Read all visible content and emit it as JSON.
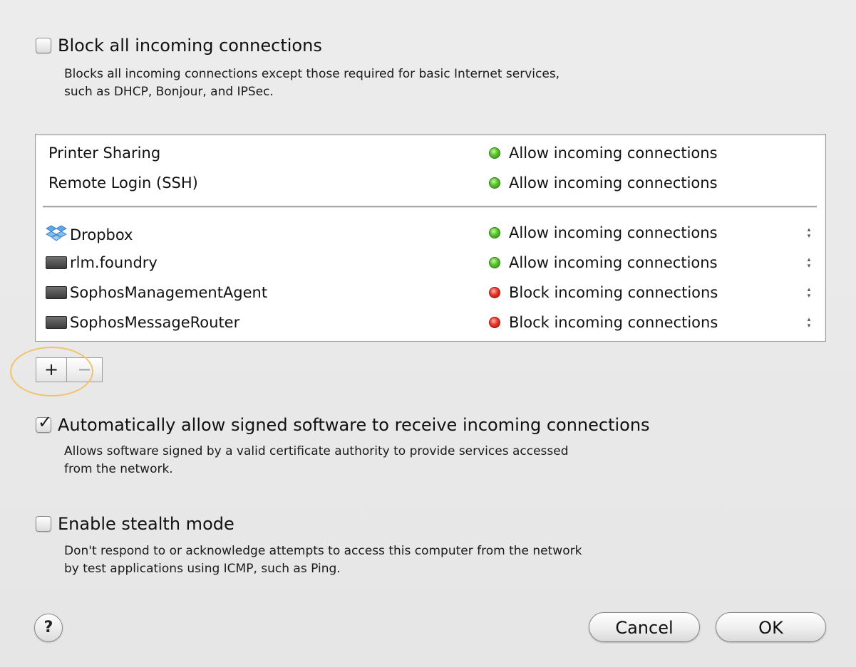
{
  "block_all": {
    "label": "Block all incoming connections",
    "checked": false,
    "description_line1": "Blocks all incoming connections except those required for basic Internet services,",
    "description_line2": "such as DHCP, Bonjour, and IPSec."
  },
  "services": [
    {
      "name": "Printer Sharing",
      "status": "Allow incoming connections",
      "status_color": "#4fbf26"
    },
    {
      "name": "Remote Login (SSH)",
      "status": "Allow incoming connections",
      "status_color": "#4fbf26"
    }
  ],
  "apps": [
    {
      "name": "Dropbox",
      "icon": "dropbox-icon",
      "status": "Allow incoming connections",
      "status_color": "#4fbf26"
    },
    {
      "name": "rlm.foundry",
      "icon": "application-icon",
      "status": "Allow incoming connections",
      "status_color": "#4fbf26"
    },
    {
      "name": "SophosManagementAgent",
      "icon": "application-icon",
      "status": "Block incoming connections",
      "status_color": "#e3322a"
    },
    {
      "name": "SophosMessageRouter",
      "icon": "application-icon",
      "status": "Block incoming connections",
      "status_color": "#e3322a"
    }
  ],
  "list_buttons": {
    "add": "+",
    "remove": "−"
  },
  "auto_allow": {
    "label": "Automatically allow signed software to receive incoming connections",
    "checked": true,
    "check_mark": "✓",
    "description_line1": "Allows software signed by a valid certificate authority to provide services accessed",
    "description_line2": "from the network."
  },
  "stealth": {
    "label": "Enable stealth mode",
    "checked": false,
    "description_line1": "Don't respond to or acknowledge attempts to access this computer from the network",
    "description_line2": "by test applications using ICMP, such as Ping."
  },
  "footer": {
    "help": "?",
    "cancel": "Cancel",
    "ok": "OK"
  },
  "colors": {
    "allow": "#4fbf26",
    "block": "#e3322a",
    "highlight_ring": "#f1c46a"
  }
}
